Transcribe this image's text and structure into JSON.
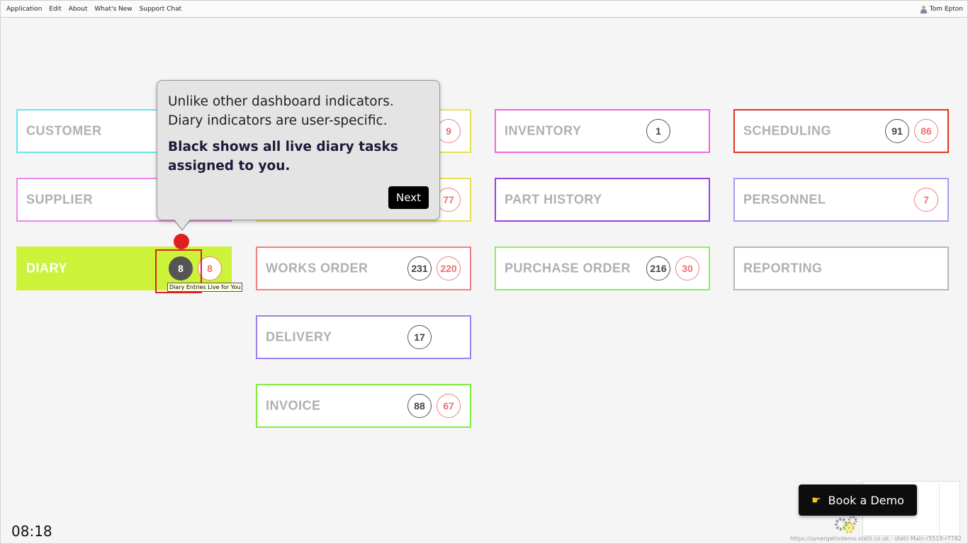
{
  "menubar": {
    "items": [
      "Application",
      "Edit",
      "About",
      "What's New",
      "Support Chat"
    ],
    "user": "Tom Epton"
  },
  "tiles": {
    "customer": {
      "label": "CUSTOMER",
      "color": "#66e6ee"
    },
    "supplier": {
      "label": "SUPPLIER",
      "color": "#ee88ee"
    },
    "diary": {
      "label": "DIARY",
      "color": "#ccf23a",
      "badge1": "8",
      "badge2": "8"
    },
    "col2_row1": {
      "badge": "9",
      "color": "#e8e050"
    },
    "col2_row2": {
      "badge": "77",
      "color": "#e8e050"
    },
    "works_order": {
      "label": "WORKS ORDER",
      "badge1": "231",
      "badge2": "220",
      "color": "#ee8080"
    },
    "delivery": {
      "label": "DELIVERY",
      "badge1": "17",
      "color": "#9f80ee"
    },
    "invoice": {
      "label": "INVOICE",
      "badge1": "88",
      "badge2": "67",
      "color": "#80ee40"
    },
    "inventory": {
      "label": "INVENTORY",
      "badge1": "1",
      "color": "#ee66dd"
    },
    "part_history": {
      "label": "PART HISTORY",
      "color": "#9940dd"
    },
    "purchase_order": {
      "label": "PURCHASE ORDER",
      "badge1": "216",
      "badge2": "30",
      "color": "#88ee66"
    },
    "scheduling": {
      "label": "SCHEDULING",
      "badge1": "91",
      "badge2": "86",
      "color": "#dd3322"
    },
    "personnel": {
      "label": "PERSONNEL",
      "badge2": "7",
      "color": "#aa99ee"
    },
    "reporting": {
      "label": "REPORTING",
      "color": "#b8b8b8"
    }
  },
  "popover": {
    "text1": "Unlike other dashboard indicators. Diary indicators are user-specific.",
    "text2": "Black shows all live diary tasks assigned to you.",
    "next_label": "Next"
  },
  "tooltip": "Diary Entries Live for You",
  "clock": "08:18",
  "demo_button": {
    "label": "Book a Demo",
    "icon": "pointing-hand-icon"
  },
  "footer_url": "https://synergetixdemo.statii.co.uk - statii Main-r5519-r7782"
}
